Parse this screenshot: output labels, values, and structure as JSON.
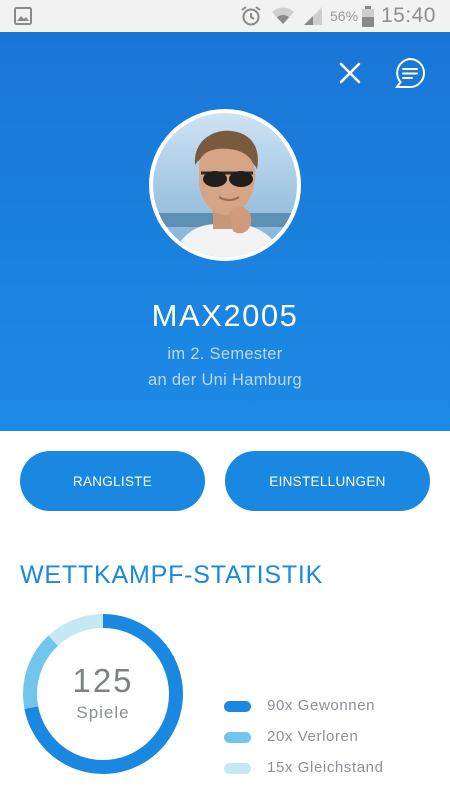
{
  "status_bar": {
    "battery_percent": "56%",
    "time": "15:40"
  },
  "header": {
    "username": "MAX2005",
    "subtitle_line1": "im 2. Semester",
    "subtitle_line2": "an der Uni Hamburg"
  },
  "buttons": {
    "ranking_label": "RANGLISTE",
    "settings_label": "EINSTELLUNGEN"
  },
  "stats": {
    "title": "WETTKAMPF-STATISTIK",
    "total": "125",
    "total_label": "Spiele",
    "legend": [
      {
        "label": "90x Gewonnen",
        "value": 90,
        "color": "#1a88e1"
      },
      {
        "label": "20x Verloren",
        "value": 20,
        "color": "#72c5ec"
      },
      {
        "label": "15x Gleichstand",
        "value": 15,
        "color": "#c4e9f4"
      }
    ]
  },
  "colors": {
    "header_blue": "#1a7fdb",
    "accent": "#1a88e1"
  }
}
